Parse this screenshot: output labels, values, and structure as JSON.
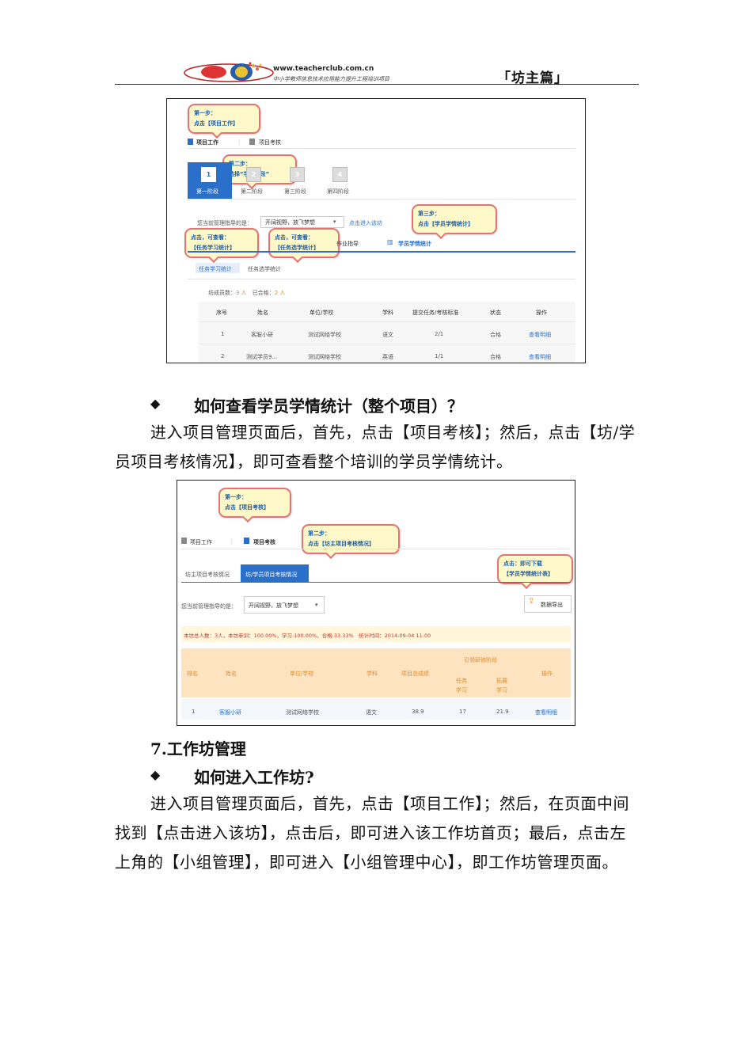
{
  "header": {
    "site_url": "www.teacherclub.com.cn",
    "site_slogan": "中小学教师信息技术应用能力提升工程培训项目",
    "section_label": "「坊主篇」"
  },
  "shot1": {
    "callouts": {
      "step1": [
        "第一步：",
        "点击【项目工作】"
      ],
      "step2": [
        "第二步：",
        "选择“学习阶段”"
      ],
      "step3": [
        "第三步：",
        "点击【学员学情统计】"
      ],
      "view_a": [
        "点击，可查看：",
        "【任务学习统计】"
      ],
      "view_b": [
        "点击，可查看：",
        "【任务选学统计】"
      ]
    },
    "tabs": {
      "work": "项目工作",
      "assess": "项目考核"
    },
    "stages": [
      {
        "num": "1",
        "label": "第一阶段"
      },
      {
        "num": "2",
        "label": "第二阶段"
      },
      {
        "num": "3",
        "label": "第三阶段"
      },
      {
        "num": "4",
        "label": "第四阶段"
      }
    ],
    "guide_label": "您当前管理指导的是：",
    "guide_value": "开阔视野，放飞梦想",
    "enter_link": "点击进入该坊",
    "subtabs": {
      "homework": "作业指导",
      "stats": "学员学情统计"
    },
    "subtabs2": {
      "learn": "任务学习统计",
      "elective": "任务选学统计"
    },
    "summary": {
      "members_label": "坊成员数：",
      "members_value": "3 人",
      "passed_label": "已合格：",
      "passed_value": "2 人"
    },
    "table": {
      "headers": [
        "序号",
        "姓名",
        "单位/学校",
        "学科",
        "提交任务/考核标准",
        "状态",
        "操作"
      ],
      "rows": [
        [
          "1",
          "客服小研",
          "测试网络学校",
          "语文",
          "2/1",
          "合格",
          "查看明细"
        ],
        [
          "2",
          "测试学员9...",
          "测试网络学校",
          "英语",
          "1/1",
          "合格",
          "查看明细"
        ]
      ]
    }
  },
  "section1": {
    "heading": "如何查看学员学情统计（整个项目）？",
    "lines": [
      "进入项目管理页面后，首先，点击【项目考核】；然后，点击【坊/学",
      "员项目考核情况】，即可查看整个培训的学员学情统计。"
    ]
  },
  "shot2": {
    "callouts": {
      "step1": [
        "第一步：",
        "点击【项目考核】"
      ],
      "step2": [
        "第二步：",
        "点击【坊主项目考核情况】"
      ],
      "download": [
        "点击：即可下载",
        "【学员学情统计表】"
      ]
    },
    "tabs": {
      "work": "项目工作",
      "assess": "项目考核"
    },
    "subtabs": {
      "owner": "坊主项目考核情况",
      "member": "坊/学员项目考核情况"
    },
    "guide_label": "您当前管理指导的是：",
    "guide_value": "开阔视野，放飞梦想",
    "export_label": "数据导出",
    "summary": "本坊总人数：3人，本坊参训：100.00%，学习:100.00%，合格:33.33%　统计时间：2014-09-04 11:00",
    "table": {
      "headers": [
        "排名",
        "姓名",
        "单位/学校",
        "学科",
        "项目总成绩",
        "引领研修阶段",
        "操作"
      ],
      "subheaders": [
        "任务学习",
        "拓展学习"
      ],
      "row": [
        "1",
        "客服小研",
        "测试网络学校",
        "语文",
        "38.9",
        "17",
        "21.9",
        "查看明细"
      ]
    }
  },
  "section2": {
    "title": "7.工作坊管理",
    "heading": "如何进入工作坊?",
    "lines": [
      "进入项目管理页面后，首先，点击【项目工作】；然后，在页面中间",
      "找到【点击进入该坊】，点击后，即可进入该工作坊首页；最后，点击左",
      "上角的【小组管理】，即可进入【小组管理中心】，即工作坊管理页面。"
    ]
  },
  "colors": {
    "accent_blue": "#2a6fc9",
    "callout_border": "#e57373",
    "callout_fill": "#fff8c8",
    "table_header_bg": "#fde3c0"
  }
}
